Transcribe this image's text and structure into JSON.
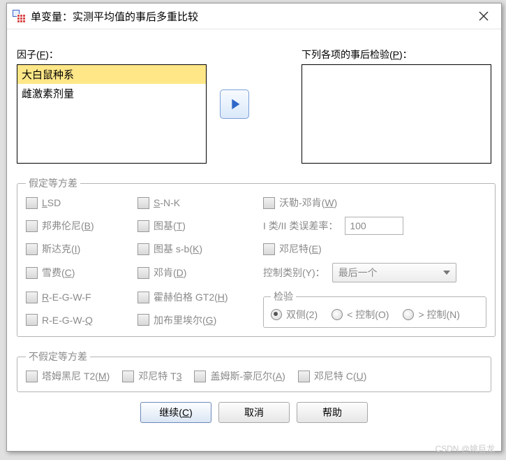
{
  "title": "单变量：实测平均值的事后多重比较",
  "labels": {
    "factors": "因子(F)：",
    "posthoc": "下列各项的事后检验(P)："
  },
  "lists": {
    "factors": [
      "大白鼠种系",
      "雌激素剂量"
    ]
  },
  "groups": {
    "equal": "假定等方差",
    "unequal": "不假定等方差",
    "test": "检验"
  },
  "equal": {
    "lsd": "LSD",
    "snk": "S-N-K",
    "waller": "沃勒-邓肯(W)",
    "bonf": "邦弗伦尼(B)",
    "tukey": "图基(T)",
    "ratio_label": "I 类/II 类误差率：",
    "ratio_value": "100",
    "sidak": "斯达克(I)",
    "tukeysb": "图基 s-b(K)",
    "dunnett": "邓尼特(E)",
    "scheffe": "雪费(C)",
    "duncan": "邓肯(D)",
    "control_label": "控制类别(Y)：",
    "control_value": "最后一个",
    "regwf": "R-E-G-W-F",
    "hochberg": "霍赫伯格 GT2(H)",
    "regwq": "R-E-G-W-Q",
    "gabriel": "加布里埃尔(G)",
    "two_sided": "双侧(2)",
    "lt_control": "< 控制(O)",
    "gt_control": "> 控制(N)"
  },
  "unequal": {
    "tamhane": "塔姆黑尼 T2(M)",
    "dunnettt3": "邓尼特 T3",
    "games": "盖姆斯-豪厄尔(A)",
    "dunnettc": "邓尼特 C(U)"
  },
  "buttons": {
    "continue": "继续(C)",
    "cancel": "取消",
    "help": "帮助"
  },
  "watermark": "CSDN @姚巨龙"
}
